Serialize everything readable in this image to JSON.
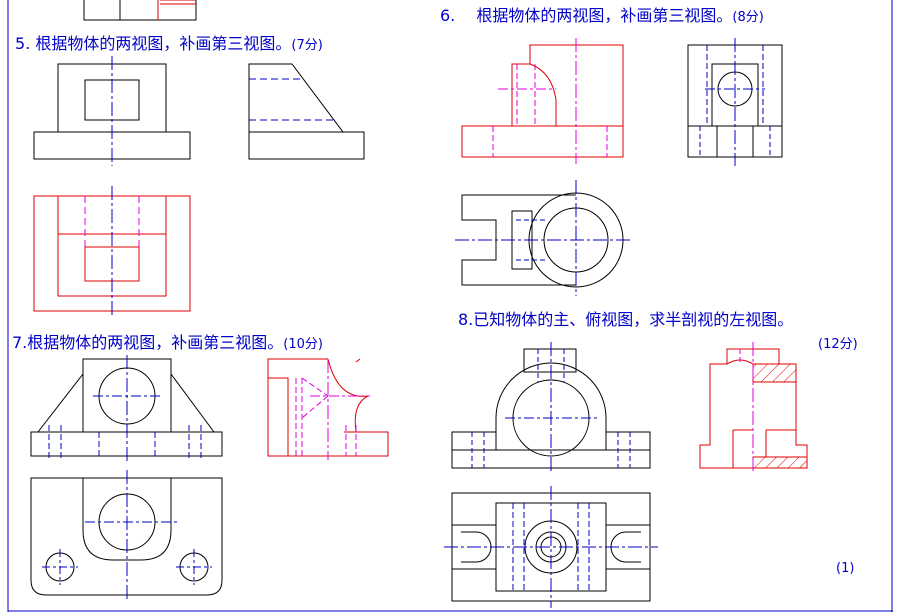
{
  "questions": [
    {
      "num": "5.",
      "text": "根据物体的两视图，补画第三视图。",
      "points": "(7分)"
    },
    {
      "num": "6.",
      "text": "根据物体的两视图，补画第三视图。",
      "points": "(8分)"
    },
    {
      "num": "7.",
      "text": "根据物体的两视图，补画第三视图。",
      "points": "(10分)"
    },
    {
      "num": "8.",
      "text": "已知物体的主、俯视图，求半剖视的左视图。",
      "points": "(12分)"
    }
  ],
  "page_marker": "(1)",
  "colors": {
    "outline": "#000000",
    "answer": "#e00000",
    "hidden_answer": "#e000e0",
    "centerline": "#0000c8",
    "text": "#0000c8",
    "border": "#0000c8"
  }
}
